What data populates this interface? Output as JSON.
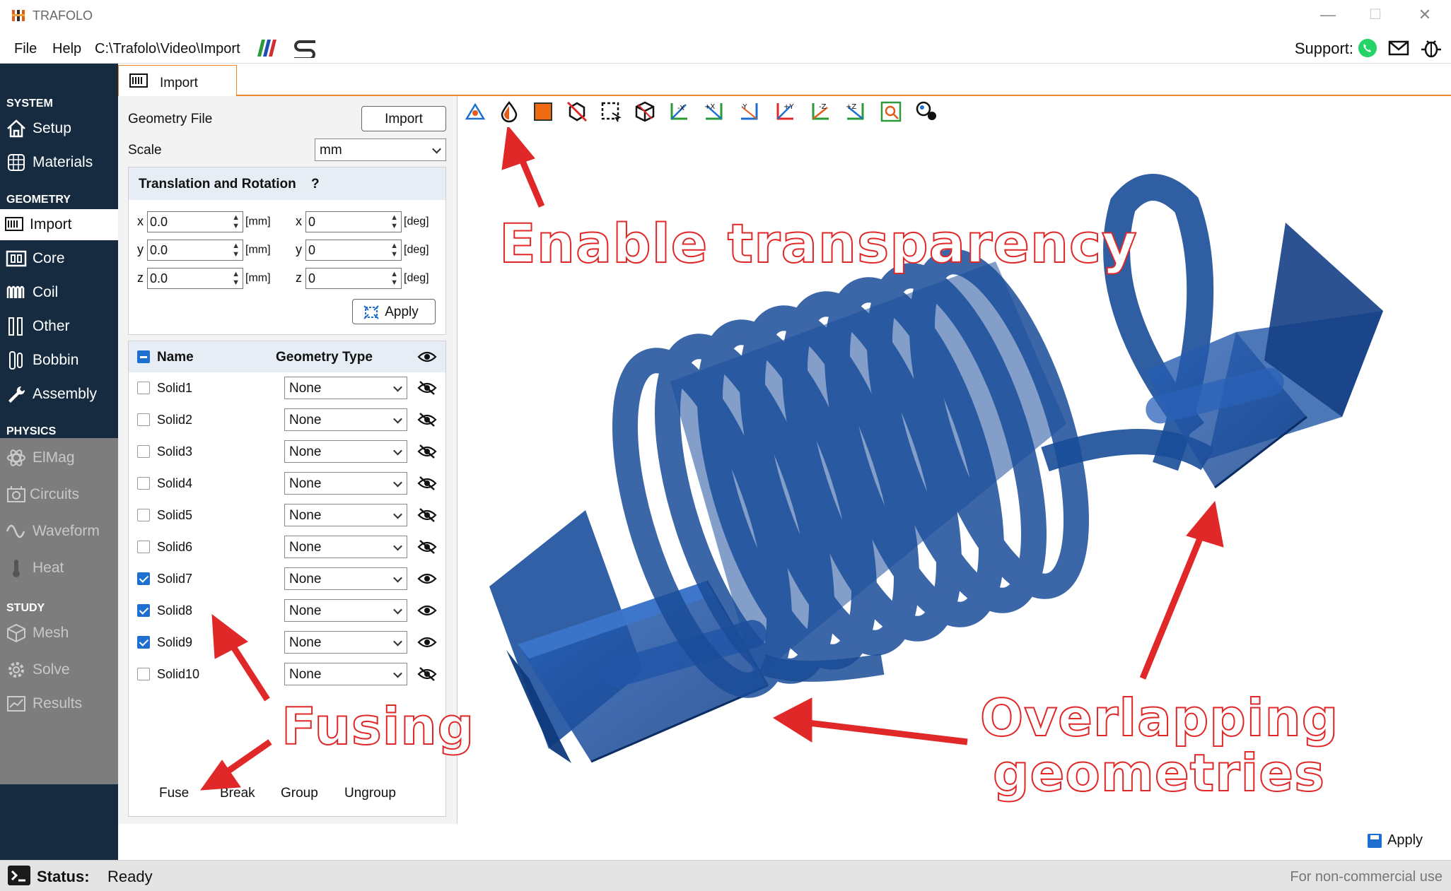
{
  "window": {
    "title": "TRAFOLO",
    "minimize": "—",
    "maximize": "☐",
    "close": "✕"
  },
  "menu": {
    "file": "File",
    "help": "Help",
    "path": "C:\\Trafolo\\Video\\Import",
    "support_label": "Support:"
  },
  "sidebar": {
    "system_label": "SYSTEM",
    "geometry_label": "GEOMETRY",
    "physics_label": "PHYSICS",
    "study_label": "STUDY",
    "items": {
      "setup": "Setup",
      "materials": "Materials",
      "import": "Import",
      "core": "Core",
      "coil": "Coil",
      "other": "Other",
      "bobbin": "Bobbin",
      "assembly": "Assembly",
      "elmag": "ElMag",
      "circuits": "Circuits",
      "waveform": "Waveform",
      "heat": "Heat",
      "mesh": "Mesh",
      "solve": "Solve",
      "results": "Results"
    }
  },
  "tab": {
    "label": "Import"
  },
  "panel": {
    "geometry_file_label": "Geometry File",
    "import_button": "Import",
    "scale_label": "Scale",
    "scale_value": "mm",
    "translation_title": "Translation and Rotation",
    "help_mark": "?",
    "tx": "0.0",
    "ty": "0.0",
    "tz": "0.0",
    "rx": "0",
    "ry": "0",
    "rz": "0",
    "len_unit": "[mm]",
    "ang_unit": "[deg]",
    "axis_x": "x",
    "axis_y": "y",
    "axis_z": "z",
    "apply_button": "Apply",
    "col_name": "Name",
    "col_type": "Geometry Type",
    "rows": [
      {
        "name": "Solid1",
        "type": "None",
        "checked": false
      },
      {
        "name": "Solid2",
        "type": "None",
        "checked": false
      },
      {
        "name": "Solid3",
        "type": "None",
        "checked": false
      },
      {
        "name": "Solid4",
        "type": "None",
        "checked": false
      },
      {
        "name": "Solid5",
        "type": "None",
        "checked": false
      },
      {
        "name": "Solid6",
        "type": "None",
        "checked": false
      },
      {
        "name": "Solid7",
        "type": "None",
        "checked": true
      },
      {
        "name": "Solid8",
        "type": "None",
        "checked": true
      },
      {
        "name": "Solid9",
        "type": "None",
        "checked": true
      },
      {
        "name": "Solid10",
        "type": "None",
        "checked": false
      }
    ],
    "fuse": "Fuse",
    "break": "Break",
    "group": "Group",
    "ungroup": "Ungroup"
  },
  "annotations": {
    "transparency": "Enable transparency",
    "fusing": "Fusing",
    "overlap_1": "Overlapping",
    "overlap_2": "geometries"
  },
  "toolbar_labels": {
    "minus_x": "-X",
    "plus_x": "+X",
    "minus_y": "-Y",
    "plus_y": "+Y",
    "minus_z": "-Z",
    "plus_z": "+Z"
  },
  "footer": {
    "apply": "Apply",
    "status_label": "Status:",
    "status_value": "Ready",
    "license": "For non-commercial use"
  },
  "colors": {
    "sidebar_bg": "#162b3f",
    "accent_orange": "#f0882a",
    "model_blue": "#1b4f9c",
    "annotation_red": "#e02828",
    "checkbox_blue": "#1e6fcf"
  }
}
